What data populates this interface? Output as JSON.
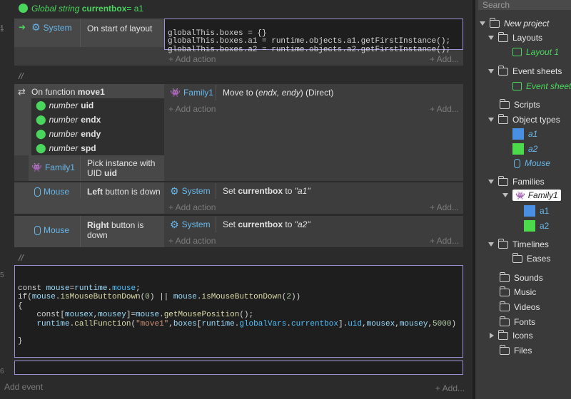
{
  "global_var": {
    "prefix": "Global string ",
    "name": "currentbox",
    "value": "= a1"
  },
  "events": {
    "e1": {
      "object": "System",
      "condition": "On start of layout",
      "code": [
        "globalThis.boxes = {}",
        "globalThis.boxes.a1 = runtime.objects.a1.getFirstInstance();",
        "globalThis.boxes.a2 = runtime.objects.a2.getFirstInstance();"
      ]
    },
    "comment1": "//",
    "e2": {
      "fn_prefix": "On function ",
      "fn_name": "move1",
      "params": [
        {
          "type": "number",
          "name": "uid"
        },
        {
          "type": "number",
          "name": "endx"
        },
        {
          "type": "number",
          "name": "endy"
        },
        {
          "type": "number",
          "name": "spd"
        }
      ],
      "action_object": "Family1",
      "action_text_a": "Move to (",
      "action_text_b": "endx, endy",
      "action_text_c": ") (Direct)",
      "sub_object": "Family1",
      "sub_condition_a": "Pick instance with UID ",
      "sub_condition_b": "uid"
    },
    "e3": {
      "object": "Mouse",
      "cond_bold": "Left",
      "cond_rest": " button is down",
      "action_object": "System",
      "action_a": "Set ",
      "action_b": "currentbox",
      "action_c": " to ",
      "action_d": "\"a1\""
    },
    "e4": {
      "object": "Mouse",
      "cond_bold": "Right",
      "cond_rest": " button is down",
      "action_object": "System",
      "action_a": "Set ",
      "action_b": "currentbox",
      "action_c": " to ",
      "action_d": "\"a2\""
    },
    "comment2": "//",
    "add_action": "+ Add action",
    "add_more": "+ Add...",
    "add_event": "Add event",
    "add_more_bottom": "+ Add..."
  },
  "project": {
    "search_placeholder": "Search",
    "root": "New project",
    "layouts": "Layouts",
    "layout1": "Layout 1",
    "event_sheets": "Event sheets",
    "event_sheet": "Event sheet",
    "scripts": "Scripts",
    "object_types": "Object types",
    "a1": "a1",
    "a2": "a2",
    "mouse": "Mouse",
    "families": "Families",
    "family1": "Family1",
    "fa1": "a1",
    "fa2": "a2",
    "timelines": "Timelines",
    "eases": "Eases",
    "sounds": "Sounds",
    "music": "Music",
    "videos": "Videos",
    "fonts": "Fonts",
    "icons": "Icons",
    "files": "Files"
  },
  "colors": {
    "accent": "#9a93d6",
    "object_blue": "#67b7ea",
    "green": "#4ad65d",
    "swatch_blue": "#4a90e2",
    "swatch_green": "#4cd94c"
  }
}
